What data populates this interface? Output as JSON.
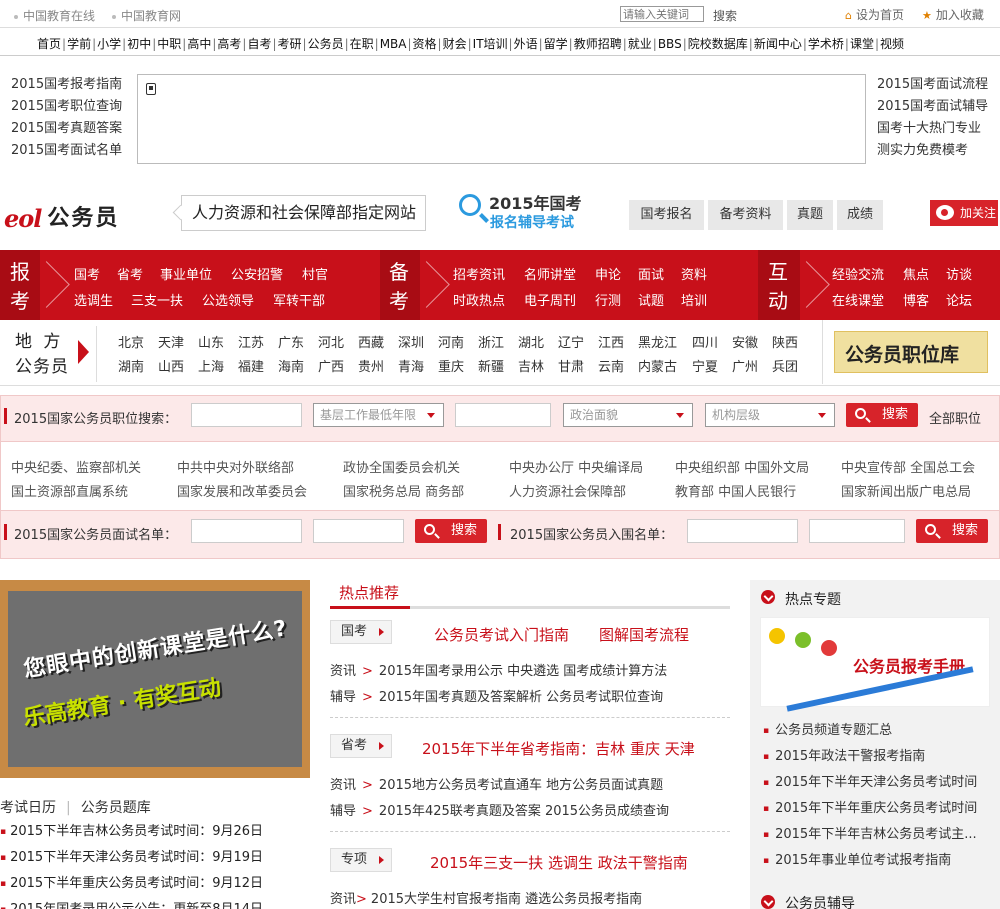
{
  "topbar": {
    "sites": [
      "中国教育在线",
      "中国教育网"
    ],
    "search_placeholder": "请输入关键词",
    "search_label": "搜索",
    "set_home": "设为首页",
    "add_fav": "加入收藏"
  },
  "nav": [
    "首页",
    "学前",
    "小学",
    "初中",
    "中职",
    "高中",
    "高考",
    "自考",
    "考研",
    "公务员",
    "在职",
    "MBA",
    "资格",
    "财会",
    "IT培训",
    "外语",
    "留学",
    "教师招聘",
    "就业",
    "BBS",
    "院校数据库",
    "新闻中心",
    "学术桥",
    "课堂",
    "视频"
  ],
  "ad": {
    "left": [
      "2015国考报考指南",
      "2015国考职位查询",
      "2015国考真题答案",
      "2015国考面试名单"
    ],
    "right": [
      "2015国考面试流程",
      "2015国考面试辅导",
      "国考十大热门专业",
      "测实力免费模考"
    ]
  },
  "header": {
    "logo_text": "eol",
    "channel": "公务员",
    "slogan": "人力资源和社会保障部指定网站",
    "promo_line1": "2015年国考",
    "promo_line2": "报名辅导考试",
    "tabs": [
      "国考报名",
      "备考资料",
      "真题",
      "成绩"
    ],
    "weibo": "加关注"
  },
  "redband": {
    "g1": {
      "title": [
        "报",
        "考"
      ],
      "row1": [
        "国考",
        "省考",
        "事业单位",
        "公安招警",
        "村官"
      ],
      "row2": [
        "选调生",
        "三支一扶",
        "公选领导",
        "军转干部"
      ]
    },
    "g2": {
      "title": [
        "备",
        "考"
      ],
      "row1": [
        "招考资讯",
        "名师讲堂",
        "申论",
        "面试",
        "资料"
      ],
      "row2": [
        "时政热点",
        "电子周刊",
        "行测",
        "试题",
        "培训"
      ]
    },
    "g3": {
      "title": [
        "互",
        "动"
      ],
      "row1": [
        "经验交流",
        "焦点",
        "访谈"
      ],
      "row2": [
        "在线课堂",
        "博客",
        "论坛"
      ]
    }
  },
  "region": {
    "title1": "地 方",
    "title2": "公务员",
    "row1": [
      "北京",
      "天津",
      "山东",
      "江苏",
      "广东",
      "河北",
      "西藏",
      "深圳",
      "河南",
      "浙江",
      "湖北",
      "辽宁",
      "江西",
      "黑龙江",
      "四川",
      "安徽",
      "陕西"
    ],
    "row2": [
      "湖南",
      "山西",
      "上海",
      "福建",
      "海南",
      "广西",
      "贵州",
      "青海",
      "重庆",
      "新疆",
      "吉林",
      "甘肃",
      "云南",
      "内蒙古",
      "宁夏",
      "广州",
      "兵团"
    ],
    "banner": "公务员职位库"
  },
  "search": {
    "label1": "2015国家公务员职位搜索：",
    "sel1": "基层工作最低年限",
    "sel2": "政治面貌",
    "sel3": "机构层级",
    "btn": "搜索",
    "all": "全部职位",
    "depts_row1": [
      "中央纪委、监察部机关",
      "中共中央对外联络部",
      "政协全国委员会机关",
      "中央办公厅 中央编译局",
      "中央组织部 中国外文局",
      "中央宣传部 全国总工会"
    ],
    "depts_row2": [
      "国土资源部直属系统",
      "国家发展和改革委员会",
      "国家税务总局 商务部",
      "人力资源社会保障部",
      "教育部 中国人民银行",
      "国家新闻出版广电总局"
    ],
    "label2": "2015国家公务员面试名单：",
    "label3": "2015国家公务员入围名单："
  },
  "left": {
    "promo1": "您眼中的创新课堂是什么?",
    "promo2": "乐高教育 · 有奖互动",
    "tab1": "考试日历",
    "tab2": "公务员题库",
    "list": [
      "2015下半年吉林公务员考试时间：9月26日",
      "2015下半年天津公务员考试时间：9月19日",
      "2015下半年重庆公务员考试时间：9月12日",
      "2015年国考录用公示公告：更新至8月14日"
    ]
  },
  "middle": {
    "title": "热点推荐",
    "b1": {
      "cat": "国考",
      "head1": "公务员考试入门指南",
      "head2": "图解国考流程",
      "r1_label": "资讯",
      "r1": "2015年国考录用公示  中央遴选  国考成绩计算方法",
      "r2_label": "辅导",
      "r2": "2015年国考真题及答案解析  公务员考试职位查询"
    },
    "b2": {
      "cat": "省考",
      "head": "2015年下半年省考指南：吉林 重庆 天津",
      "r1_label": "资讯",
      "r1": "2015地方公务员考试直通车  地方公务员面试真题",
      "r2_label": "辅导",
      "r2": "2015年425联考真题及答案   2015公务员成绩查询"
    },
    "b3": {
      "cat": "专项",
      "head": "2015年三支一扶 选调生 政法干警指南",
      "r1_label": "资讯",
      "r1": "2015大学生村官报考指南  遴选公务员报考指南"
    }
  },
  "right": {
    "title1": "热点专题",
    "handbook": "公务员报考手册",
    "list": [
      "公务员频道专题汇总",
      "2015年政法干警报考指南",
      "2015年下半年天津公务员考试时间",
      "2015年下半年重庆公务员考试时间",
      "2015年下半年吉林公务员考试主...",
      "2015年事业单位考试报考指南"
    ],
    "title2": "公务员辅导"
  }
}
